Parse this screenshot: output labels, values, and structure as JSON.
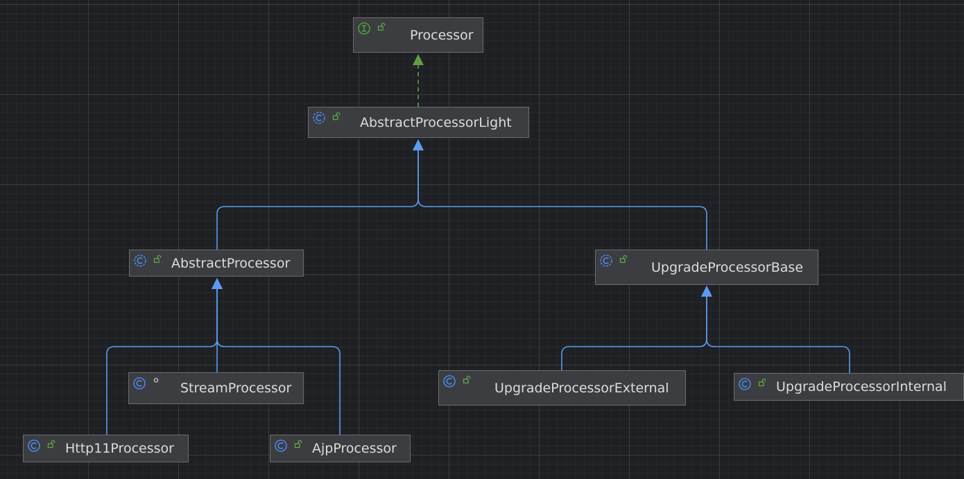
{
  "diagram": {
    "background": "#1f2024",
    "colors": {
      "node_fill": "#3c3d40",
      "node_border": "#6b6d71",
      "text": "#dcdde0",
      "inherit_edge": "#5b9cf2",
      "implements_edge": "#5f9e46",
      "interface_icon": "#4f9e3f",
      "class_icon": "#4a86e8",
      "public_icon": "#5ea84a"
    },
    "nodes": [
      {
        "id": "processor",
        "label": "Processor",
        "kind": "interface-icon",
        "visibility": "public-icon"
      },
      {
        "id": "abstract_processor_light",
        "label": "AbstractProcessorLight",
        "kind": "abstract-class-icon",
        "visibility": "public-icon"
      },
      {
        "id": "abstract_processor",
        "label": "AbstractProcessor",
        "kind": "abstract-class-icon",
        "visibility": "public-icon"
      },
      {
        "id": "upgrade_processor_base",
        "label": "UpgradeProcessorBase",
        "kind": "abstract-class-icon",
        "visibility": "public-icon"
      },
      {
        "id": "stream_processor",
        "label": "StreamProcessor",
        "kind": "class-icon",
        "visibility": "package-private-icon"
      },
      {
        "id": "http11_processor",
        "label": "Http11Processor",
        "kind": "class-icon",
        "visibility": "public-icon"
      },
      {
        "id": "ajp_processor",
        "label": "AjpProcessor",
        "kind": "class-icon",
        "visibility": "public-icon"
      },
      {
        "id": "upgrade_processor_external",
        "label": "UpgradeProcessorExternal",
        "kind": "class-icon",
        "visibility": "public-icon"
      },
      {
        "id": "upgrade_processor_internal",
        "label": "UpgradeProcessorInternal",
        "kind": "class-icon",
        "visibility": "public-icon"
      }
    ],
    "edges": [
      {
        "from": "abstract_processor_light",
        "to": "processor",
        "type": "implements"
      },
      {
        "from": "abstract_processor",
        "to": "abstract_processor_light",
        "type": "extends"
      },
      {
        "from": "upgrade_processor_base",
        "to": "abstract_processor_light",
        "type": "extends"
      },
      {
        "from": "http11_processor",
        "to": "abstract_processor",
        "type": "extends"
      },
      {
        "from": "stream_processor",
        "to": "abstract_processor",
        "type": "extends"
      },
      {
        "from": "ajp_processor",
        "to": "abstract_processor",
        "type": "extends"
      },
      {
        "from": "upgrade_processor_external",
        "to": "upgrade_processor_base",
        "type": "extends"
      },
      {
        "from": "upgrade_processor_internal",
        "to": "upgrade_processor_base",
        "type": "extends"
      }
    ]
  }
}
